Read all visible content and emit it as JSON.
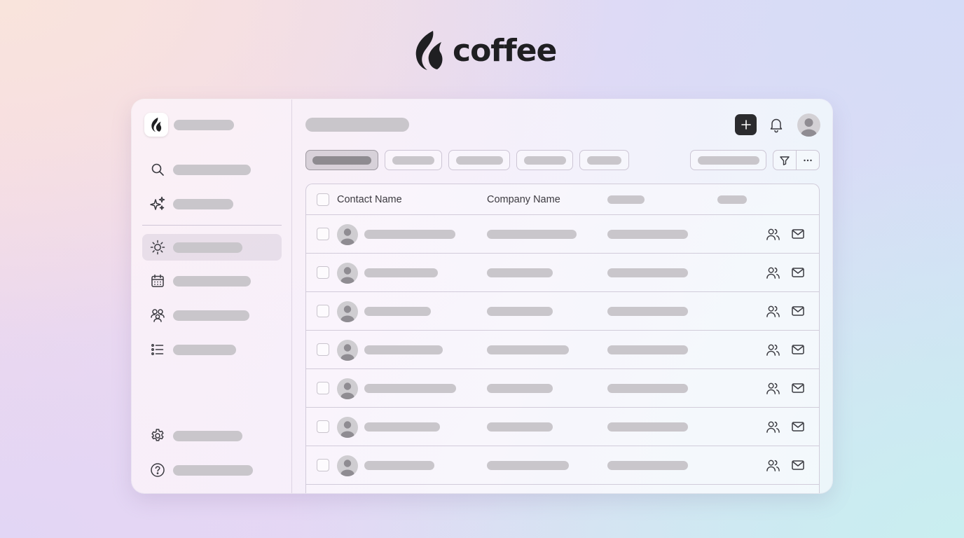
{
  "brand": {
    "name": "coffee",
    "logo_icon": "flame-leaf-logo"
  },
  "window": {
    "sidebar": {
      "logo_icon": "flame-leaf-logo",
      "top_items": [
        {
          "icon": "search-icon",
          "active": false
        },
        {
          "icon": "sparkles-icon",
          "active": false
        }
      ],
      "nav_items": [
        {
          "icon": "sun-icon",
          "active": true
        },
        {
          "icon": "calendar-icon",
          "active": false
        },
        {
          "icon": "users-icon",
          "active": false
        },
        {
          "icon": "list-icon",
          "active": false
        }
      ],
      "bottom_items": [
        {
          "icon": "gear-icon",
          "active": false
        },
        {
          "icon": "help-icon",
          "active": false
        }
      ]
    },
    "header": {
      "add_icon": "plus-icon",
      "notification_icon": "bell-icon",
      "avatar_icon": "user-avatar"
    },
    "tabs": {
      "count": 5,
      "active_index": 0
    },
    "toolbar": {
      "filter_icon": "filter-icon",
      "more_icon": "more-horizontal-icon"
    },
    "table": {
      "columns": [
        "Contact Name",
        "Company Name",
        "",
        ""
      ],
      "row_count": 7,
      "row_actions": [
        "users-icon",
        "mail-icon"
      ]
    }
  },
  "colors": {
    "accent_dark": "#2b2b2e",
    "placeholder_bar": "#c9c6cb",
    "active_tab_bar": "#8e8b90"
  }
}
